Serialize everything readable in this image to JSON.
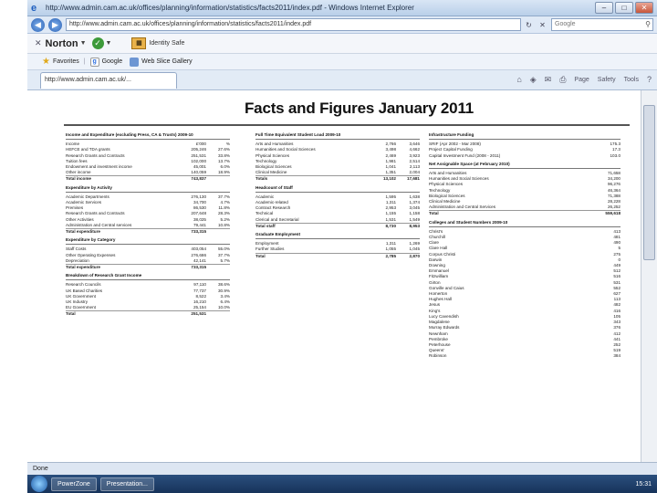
{
  "window": {
    "title": "http://www.admin.cam.ac.uk/offices/planning/information/statistics/facts2011/index.pdf - Windows Internet Explorer"
  },
  "address": {
    "url": "http://www.admin.cam.ac.uk/offices/planning/information/statistics/facts2011/index.pdf",
    "search_placeholder": "Google"
  },
  "norton": {
    "brand": "Norton",
    "safe_label": "Identity Safe"
  },
  "favorites": {
    "label": "Favorites",
    "items": [
      "Google",
      "Web Slice Gallery"
    ]
  },
  "tab": {
    "label": "http://www.admin.cam.ac.uk/..."
  },
  "commands": [
    "Page",
    "Safety",
    "Tools",
    "Help"
  ],
  "doc": {
    "title": "Facts and Figures January 2011",
    "income": {
      "heading": "Income and Expenditure (excluding Press, CA & Trusts) 2009-10",
      "rows": [
        [
          "Income",
          "£'000",
          "%"
        ],
        [
          "HEFCE and TDA grants",
          "205,246",
          "27.6%"
        ],
        [
          "Research Grants and Contracts",
          "251,531",
          "33.8%"
        ],
        [
          "Tuition fees",
          "102,000",
          "13.7%"
        ],
        [
          "Endowment and investment income",
          "45,001",
          "6.0%"
        ],
        [
          "Other income",
          "140,059",
          "18.9%"
        ],
        [
          "Total income",
          "743,837",
          ""
        ]
      ],
      "activity_heading": "Expenditure by Activity",
      "activity_rows": [
        [
          "Academic Departments",
          "276,130",
          "37.7%"
        ],
        [
          "Academic Services",
          "34,700",
          "4.7%"
        ],
        [
          "Premises",
          "86,530",
          "11.8%"
        ],
        [
          "Research Grants and Contracts",
          "207,648",
          "28.3%"
        ],
        [
          "Other Activities",
          "38,025",
          "5.2%"
        ],
        [
          "Administration and Central services",
          "79,441",
          "10.8%"
        ],
        [
          "Total expenditure",
          "733,315",
          ""
        ]
      ],
      "category_heading": "Expenditure by Category",
      "category_rows": [
        [
          "Staff Costs",
          "403,054",
          "55.0%"
        ],
        [
          "Other Operating Expenses",
          "276,686",
          "37.7%"
        ],
        [
          "Depreciation",
          "42,141",
          "5.7%"
        ],
        [
          "Total expenditure",
          "733,315",
          ""
        ]
      ],
      "research_heading": "Breakdown of Research Grant Income",
      "research_rows": [
        [
          "Research Councils",
          "97,110",
          "38.6%"
        ],
        [
          "UK Based Charities",
          "77,737",
          "30.9%"
        ],
        [
          "UK Government",
          "8,522",
          "3.4%"
        ],
        [
          "UK Industry",
          "16,210",
          "6.4%"
        ],
        [
          "EU Government",
          "25,154",
          "10.0%"
        ],
        [
          "Total",
          "251,531",
          ""
        ]
      ]
    },
    "students": {
      "heading": "Full Time Equivalent Student Load 2009-10",
      "rows": [
        [
          "Arts and Humanities",
          "2,766",
          "3,646"
        ],
        [
          "Humanities and Social Sciences",
          "3,498",
          "4,662"
        ],
        [
          "Physical Sciences",
          "2,469",
          "3,923"
        ],
        [
          "Technology",
          "1,981",
          "2,514"
        ],
        [
          "Biological Sciences",
          "1,041",
          "2,113"
        ],
        [
          "Clinical Medicine",
          "1,351",
          "2,004"
        ],
        [
          "Totals",
          "13,102",
          "17,681"
        ]
      ],
      "staff_heading": "Headcount of Staff",
      "staff_rows": [
        [
          "Academic",
          "1,595",
          "1,638"
        ],
        [
          "Academic-related",
          "1,311",
          "1,374"
        ],
        [
          "Contract Research",
          "2,953",
          "3,045"
        ],
        [
          "Technical",
          "1,155",
          "1,158"
        ],
        [
          "Clerical and Secretarial",
          "1,531",
          "1,549"
        ],
        [
          "Total staff",
          "8,730",
          "8,953"
        ]
      ],
      "grad_heading": "Graduate Employment",
      "grad_rows": [
        [
          "Employment",
          "1,311",
          "1,269"
        ],
        [
          "Further Studies",
          "1,055",
          "1,045"
        ],
        [
          "Total",
          "2,785",
          "2,870"
        ]
      ]
    },
    "infra": {
      "heading": "Infrastructure Funding",
      "rows": [
        [
          "SRIF (Apr 2002 - Mar 2008)",
          "175.3"
        ],
        [
          "Project Capital Funding",
          "17.3"
        ],
        [
          "Capital Investment Fund (2008 - 2011)",
          "103.0"
        ]
      ],
      "space_heading": "Net Assignable Space (at February 2010)",
      "space_rows": [
        [
          "Arts and Humanities",
          "71,658"
        ],
        [
          "Humanities and Social Sciences",
          "34,200"
        ],
        [
          "Physical Sciences",
          "96,276"
        ],
        [
          "Technology",
          "46,364"
        ],
        [
          "Biological Sciences",
          "71,388"
        ],
        [
          "Clinical Medicine",
          "28,228"
        ],
        [
          "Administration and Central Services",
          "26,252"
        ],
        [
          "Total",
          "559,618"
        ]
      ],
      "colleges_heading": "Colleges and Student Numbers 2009-10",
      "colleges_rows": [
        [
          "Christ's",
          "413"
        ],
        [
          "Churchill",
          "481"
        ],
        [
          "Clare",
          "490"
        ],
        [
          "Clare Hall",
          "5"
        ],
        [
          "Corpus Christi",
          "275"
        ],
        [
          "Darwin",
          "0"
        ],
        [
          "Downing",
          "449"
        ],
        [
          "Emmanuel",
          "512"
        ],
        [
          "Fitzwilliam",
          "516"
        ],
        [
          "Girton",
          "531"
        ],
        [
          "Gonville and Caius",
          "552"
        ],
        [
          "Homerton",
          "627"
        ],
        [
          "Hughes Hall",
          "113"
        ],
        [
          "Jesus",
          "482"
        ],
        [
          "King's",
          "416"
        ],
        [
          "Lucy Cavendish",
          "105"
        ],
        [
          "Magdalene",
          "343"
        ],
        [
          "Murray Edwards",
          "376"
        ],
        [
          "Newnham",
          "412"
        ],
        [
          "Pembroke",
          "441"
        ],
        [
          "Peterhouse",
          "252"
        ],
        [
          "Queens'",
          "519"
        ],
        [
          "Robinson",
          "384"
        ]
      ]
    }
  },
  "status": {
    "text": "Done"
  },
  "taskbar": {
    "items": [
      "PowerZone",
      "Presentation..."
    ],
    "clock": "15:31"
  }
}
